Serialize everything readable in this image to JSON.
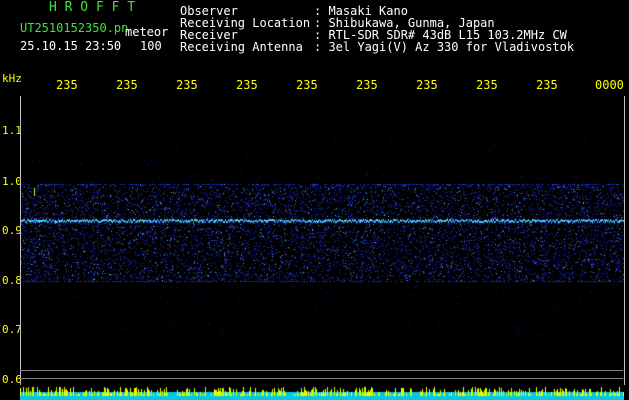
{
  "header": {
    "brand": "H R O F F T",
    "filename": "UT2510152350.pn",
    "mode": "meteor",
    "datetime": "25.10.15 23:50",
    "count": "100"
  },
  "info": {
    "labels": [
      "Observer",
      "Receiving Location",
      "Receiver",
      "Receiving Antenna"
    ],
    "values": [
      ": Masaki Kano",
      ": Shibukawa, Gunma, Japan",
      ": RTL-SDR SDR# 43dB L15 103.2MHz CW",
      ": 3el Yagi(V) Az 330 for Vladivostok"
    ]
  },
  "axes": {
    "unit": "kHz",
    "y_ticks": [
      "1.1",
      "1.0",
      "0.9",
      "0.8",
      "0.7",
      "0.6"
    ],
    "x_ticks": [
      "235",
      "235",
      "235",
      "235",
      "235",
      "235",
      "235",
      "235",
      "235",
      "0000"
    ]
  },
  "colors": {
    "brand": "#39e639",
    "label": "#ffffff",
    "value": "#ffffff",
    "axis": "#ffff00",
    "signal": "#2b8cff",
    "noise": "#1a1aa0"
  }
}
